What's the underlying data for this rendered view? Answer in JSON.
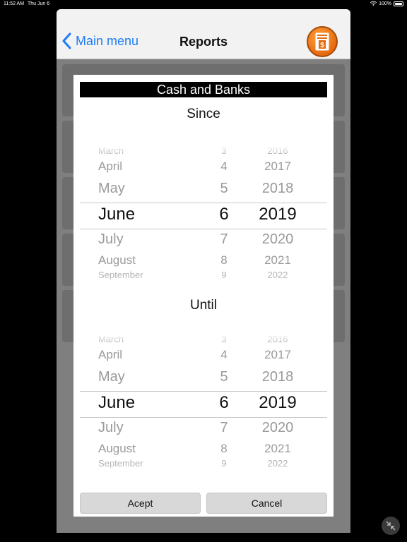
{
  "status_bar": {
    "time": "11:52 AM",
    "date": "Thu Jun 6",
    "battery": "100%"
  },
  "navbar": {
    "back_label": "Main menu",
    "title": "Reports",
    "report_icon": "report-document-dollar-icon"
  },
  "dialog": {
    "title": "Cash and Banks",
    "since_label": "Since",
    "until_label": "Until",
    "pickers": [
      {
        "id": "since",
        "months": [
          "March",
          "April",
          "May",
          "June",
          "July",
          "August",
          "September"
        ],
        "days": [
          "3",
          "4",
          "5",
          "6",
          "7",
          "8",
          "9"
        ],
        "years": [
          "2016",
          "2017",
          "2018",
          "2019",
          "2020",
          "2021",
          "2022"
        ],
        "selected": {
          "month": "June",
          "day": "6",
          "year": "2019"
        }
      },
      {
        "id": "until",
        "months": [
          "March",
          "April",
          "May",
          "June",
          "July",
          "August",
          "September"
        ],
        "days": [
          "3",
          "4",
          "5",
          "6",
          "7",
          "8",
          "9"
        ],
        "years": [
          "2016",
          "2017",
          "2018",
          "2019",
          "2020",
          "2021",
          "2022"
        ],
        "selected": {
          "month": "June",
          "day": "6",
          "year": "2019"
        }
      }
    ],
    "accept_label": "Acept",
    "cancel_label": "Cancel"
  },
  "colors": {
    "accent": "#1e7cf6",
    "report_button": "#f07d1e",
    "overlay": "#7f7f7f",
    "title_bar": "#000000"
  }
}
